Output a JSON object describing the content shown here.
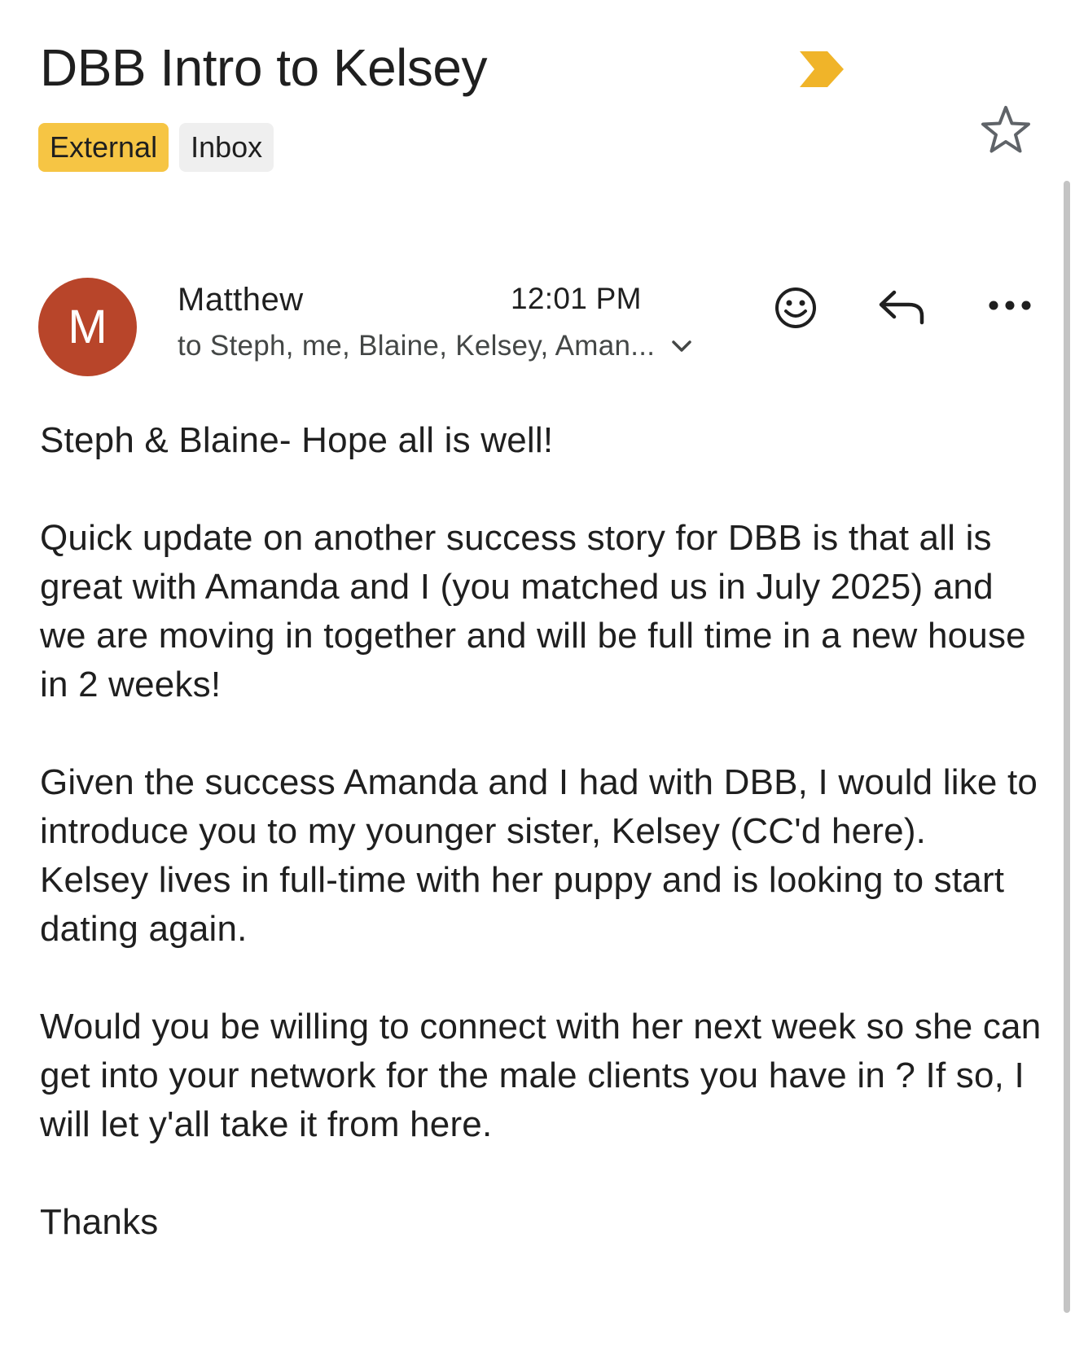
{
  "email": {
    "subject": "DBB Intro to Kelsey",
    "labels": [
      "External",
      "Inbox"
    ],
    "sender": "Matthew",
    "avatar_letter": "M",
    "time": "12:01 PM",
    "recipients": "to Steph, me, Blaine, Kelsey, Aman...",
    "body": [
      "Steph & Blaine- Hope all is well!",
      "Quick update on another success story for DBB is that all is great with Amanda and I (you matched us in July 2025) and we are moving in together and will be full time in a new house in 2 weeks!",
      "Given the success Amanda and I had with DBB, I would like to introduce you to my younger sister, Kelsey (CC'd here). Kelsey lives in full-time with her puppy and is looking to start dating again.",
      "Would you be willing to connect with her next week so she can get into your network for the male clients you have in ? If so, I will let y'all take it from here.",
      "Thanks"
    ]
  },
  "colors": {
    "external_label": "#f6c544",
    "inbox_label": "#efefef",
    "avatar": "#b8452a",
    "important_marker": "#f0b429"
  },
  "icons": {
    "important": "important-marker-icon",
    "star": "star-icon",
    "emoji": "smiley-icon",
    "reply": "reply-icon",
    "more": "more-horizontal-icon",
    "expand": "chevron-down-icon"
  }
}
